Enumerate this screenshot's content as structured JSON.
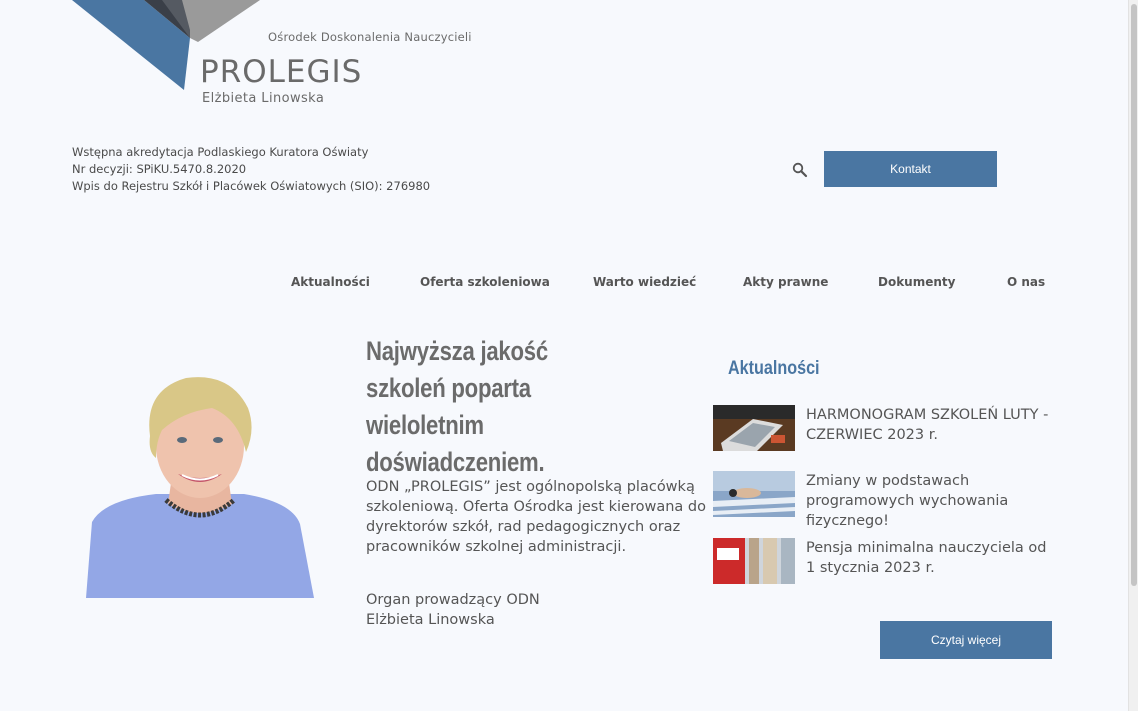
{
  "logo": {
    "subtitle": "Ośrodek Doskonalenia Nauczycieli",
    "brand": "PROLEGIS",
    "owner": "Elżbieta Linowska"
  },
  "accreditation": {
    "line1": "Wstępna akredytacja Podlaskiego Kuratora Oświaty",
    "line2": "Nr decyzji: SPiKU.5470.8.2020",
    "line3": "Wpis do Rejestru Szkół i Placówek Oświatowych (SIO): 276980"
  },
  "header": {
    "search_icon": "search-icon",
    "contact_label": "Kontakt"
  },
  "nav": {
    "items": [
      {
        "label": "Aktualności"
      },
      {
        "label": "Oferta szkoleniowa"
      },
      {
        "label": "Warto wiedzieć"
      },
      {
        "label": "Akty prawne"
      },
      {
        "label": "Dokumenty"
      },
      {
        "label": "O nas"
      }
    ]
  },
  "hero": {
    "title": "Najwyższa jakość szkoleń poparta wieloletnim doświadczeniem.",
    "text": "ODN „PROLEGIS” jest ogólnopolską placówką szkoleniową. Oferta Ośrodka jest kierowana do dyrektorów szkół, rad pedagogicznych oraz pracowników szkolnej administracji.",
    "organ_line1": "Organ prowadzący ODN",
    "organ_line2": "Elżbieta Linowska"
  },
  "news": {
    "heading": "Aktualności",
    "items": [
      {
        "title": "HARMONOGRAM SZKOLEŃ LUTY - CZERWIEC 2023 r."
      },
      {
        "title": "Zmiany w podstawach programowych wychowania fizycznego!"
      },
      {
        "title": "Pensja minimalna nauczyciela od 1 stycznia 2023 r."
      }
    ],
    "more_label": "Czytaj więcej"
  },
  "colors": {
    "accent": "#4a76a2",
    "background": "#f7f9fd",
    "text": "#555555"
  }
}
